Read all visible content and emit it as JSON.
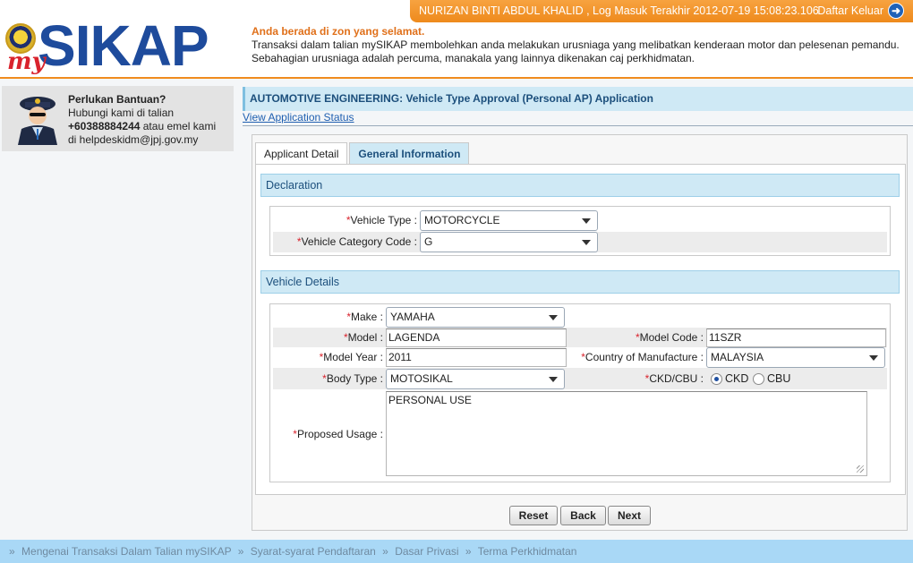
{
  "logo": {
    "prefix": "my",
    "name": "SIKAP"
  },
  "userbar": {
    "user_info": "NURIZAN BINTI ABDUL KHALID , Log Masuk Terakhir 2012-07-19 15:08:23.106",
    "logout_label": "Daftar Keluar"
  },
  "notice": {
    "safe_zone": "Anda berada di zon yang selamat.",
    "description": "Transaksi dalam talian mySIKAP membolehkan anda melakukan urusniaga yang melibatkan kenderaan motor dan pelesenan pemandu. Sebahagian urusniaga adalah percuma, manakala yang lainnya dikenakan caj perkhidmatan."
  },
  "help": {
    "title": "Perlukan Bantuan?",
    "line1": "Hubungi kami di talian",
    "phone": "+60388884244",
    "line2_suffix": " atau emel kami",
    "email_line": "di helpdeskidm@jpj.gov.my"
  },
  "page": {
    "title": "AUTOMOTIVE ENGINEERING: Vehicle Type Approval (Personal AP) Application",
    "status_link": "View Application Status"
  },
  "tabs": [
    {
      "label": "Applicant Detail"
    },
    {
      "label": "General Information"
    }
  ],
  "declaration": {
    "header": "Declaration",
    "vehicle_type_label": "Vehicle Type :",
    "vehicle_type_value": "MOTORCYCLE",
    "category_code_label": "Vehicle Category Code :",
    "category_code_value": "G"
  },
  "vehicle_details": {
    "header": "Vehicle Details",
    "make_label": "Make :",
    "make_value": "YAMAHA",
    "model_label": "Model :",
    "model_value": "LAGENDA",
    "model_code_label": "Model Code :",
    "model_code_value": "11SZR",
    "model_year_label": "Model Year :",
    "model_year_value": "2011",
    "country_label": "Country of Manufacture :",
    "country_value": "MALAYSIA",
    "body_type_label": "Body Type :",
    "body_type_value": "MOTOSIKAL",
    "ckd_cbu_label": "CKD/CBU :",
    "ckd_option": "CKD",
    "cbu_option": "CBU",
    "ckd_selected": true,
    "proposed_usage_label": "Proposed Usage :",
    "proposed_usage_value": "PERSONAL USE"
  },
  "required_mark": "*",
  "buttons": {
    "reset": "Reset",
    "back": "Back",
    "next": "Next"
  },
  "footer": {
    "separator": "»",
    "links": [
      "Mengenai Transaksi Dalam Talian mySIKAP",
      "Syarat-syarat Pendaftaran",
      "Dasar Privasi",
      "Terma Perkhidmatan"
    ]
  },
  "colors": {
    "orange_accent": "#f08c1e",
    "brand_blue": "#1e4b9c",
    "header_bar_light_blue": "#cfe9f5",
    "required_red": "#d9232d"
  }
}
